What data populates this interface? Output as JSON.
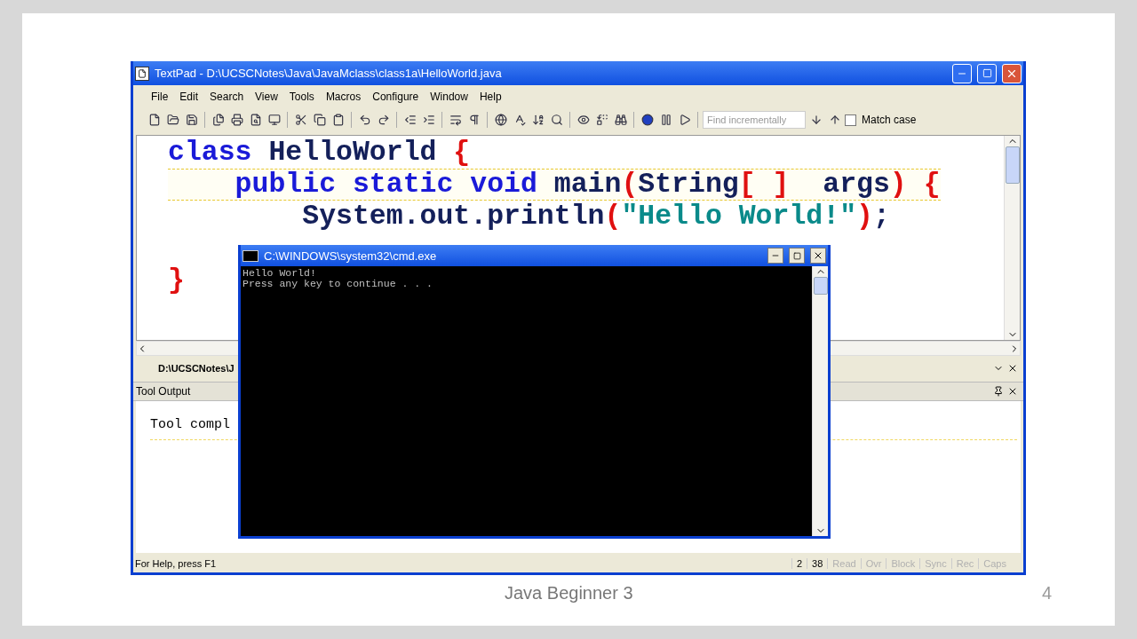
{
  "slide": {
    "footer": "Java Beginner 3",
    "page_number": "4"
  },
  "textpad": {
    "title": "TextPad - D:\\UCSCNotes\\Java\\JavaMclass\\class1a\\HelloWorld.java",
    "menu": [
      "File",
      "Edit",
      "Search",
      "View",
      "Tools",
      "Macros",
      "Configure",
      "Window",
      "Help"
    ],
    "search": {
      "placeholder": "Find incrementally"
    },
    "match_case": {
      "label": "Match case",
      "checked": false
    },
    "code_lines": [
      {
        "current": false,
        "tokens": [
          {
            "kind": "keyword",
            "text": "class"
          },
          {
            "kind": "plain",
            "text": " HelloWorld "
          },
          {
            "kind": "brace",
            "text": "{"
          }
        ]
      },
      {
        "current": true,
        "tokens": [
          {
            "kind": "keyword",
            "text": "    public static void"
          },
          {
            "kind": "plain",
            "text": " main"
          },
          {
            "kind": "brace",
            "text": "("
          },
          {
            "kind": "plain",
            "text": "String"
          },
          {
            "kind": "brace",
            "text": "[ ]"
          },
          {
            "kind": "plain",
            "text": "  args"
          },
          {
            "kind": "brace",
            "text": ") {"
          }
        ]
      },
      {
        "current": false,
        "tokens": [
          {
            "kind": "plain",
            "text": "        System.out.println"
          },
          {
            "kind": "brace",
            "text": "("
          },
          {
            "kind": "string",
            "text": "\"Hello World!\""
          },
          {
            "kind": "brace",
            "text": ")"
          },
          {
            "kind": "plain",
            "text": ";"
          }
        ]
      },
      {
        "current": false,
        "tokens": [
          {
            "kind": "brace",
            "text": "}"
          }
        ]
      }
    ],
    "document_tab": {
      "label": "D:\\UCSCNotes\\J"
    },
    "tool_output": {
      "title": "Tool Output",
      "text": "Tool compl"
    },
    "status_bar": {
      "help": "For Help, press F1",
      "line": "2",
      "column": "38",
      "indicators": [
        {
          "label": "Read",
          "active": false
        },
        {
          "label": "Ovr",
          "active": false
        },
        {
          "label": "Block",
          "active": false
        },
        {
          "label": "Sync",
          "active": false
        },
        {
          "label": "Rec",
          "active": false
        },
        {
          "label": "Caps",
          "active": false
        }
      ]
    }
  },
  "cmd": {
    "title": "C:\\WINDOWS\\system32\\cmd.exe",
    "lines": [
      "Hello World!",
      "Press any key to continue . . ."
    ]
  }
}
